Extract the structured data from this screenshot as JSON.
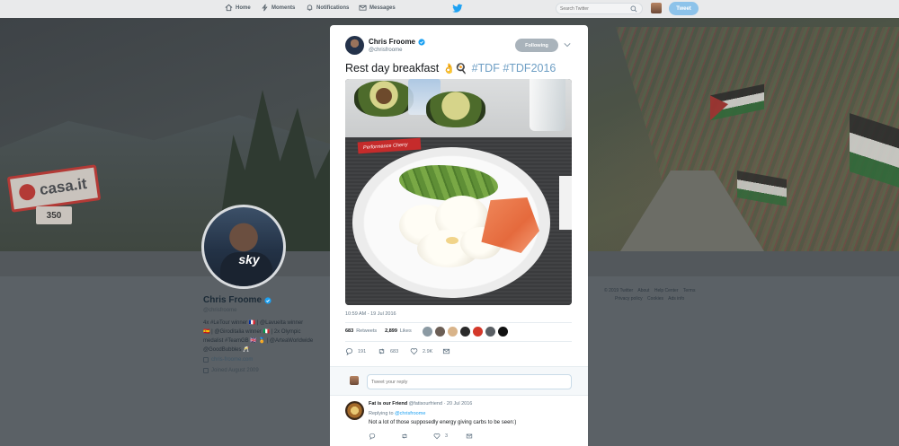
{
  "nav": {
    "items": [
      {
        "label": "Home",
        "icon": "home-icon"
      },
      {
        "label": "Moments",
        "icon": "lightning-icon"
      },
      {
        "label": "Notifications",
        "icon": "bell-icon"
      },
      {
        "label": "Messages",
        "icon": "envelope-icon"
      }
    ],
    "search_placeholder": "Search Twitter",
    "tweet_button": "Tweet"
  },
  "banner": {
    "sign_text": "casa.it",
    "km_text": "350"
  },
  "profile": {
    "name": "Chris Froome",
    "handle": "@chrisfroome",
    "bio_line1": "4x #LeTour winner 🇫🇷 | @Lavuelta winner",
    "bio_line2": "🇪🇸 | @Giroditalia winner 🇮🇹 | 2x Olympic",
    "bio_line3": "medalist #TeamGB 🇬🇧 🏅 | @ArteaWorldwide",
    "bio_line4": "@GoodBubbles 🥂",
    "website": "chris-froome.com",
    "joined": "Joined August 2009",
    "jersey_text": "sky"
  },
  "footer": {
    "links": [
      "© 2019 Twitter",
      "About",
      "Help Center",
      "Terms",
      "Privacy policy",
      "Cookies",
      "Ads info"
    ]
  },
  "tweet": {
    "author_name": "Chris Froome",
    "author_handle": "@chrisfroome",
    "follow_label": "Following",
    "text": "Rest day breakfast",
    "emoji": "👌🍳",
    "hashtags": "#TDF #TDF2016",
    "photo_pack_text": "Performance Cherry",
    "timestamp": "10:59 AM - 19 Jul 2016",
    "retweets_count": "683",
    "retweets_label": "Retweets",
    "likes_count": "2,899",
    "likes_label": "Likes",
    "likers": [
      "#8b9aa3",
      "#6b5e55",
      "#d9b48a",
      "#2a2a2a",
      "#d4382a",
      "#5a5f64",
      "#111111"
    ],
    "actions": {
      "replies": "191",
      "retweets": "683",
      "likes": "2.9K"
    },
    "reply_placeholder": "Tweet your reply"
  },
  "comment": {
    "name": "Fat is our Friend",
    "handle": "@fatisourfriend",
    "date": "· 20 Jul 2016",
    "replying_prefix": "Replying to",
    "replying_to": "@chrisfroome",
    "text": "Not a lot of those supposedly energy giving carbs to be seen:)",
    "actions": {
      "replies": "",
      "retweets": "",
      "likes": "3"
    }
  },
  "colors": {
    "accent": "#1da1f2",
    "hashtag": "#6d9ec4",
    "follow_button": "#a9b3bb",
    "tweet_button": "#8dc3ea"
  }
}
